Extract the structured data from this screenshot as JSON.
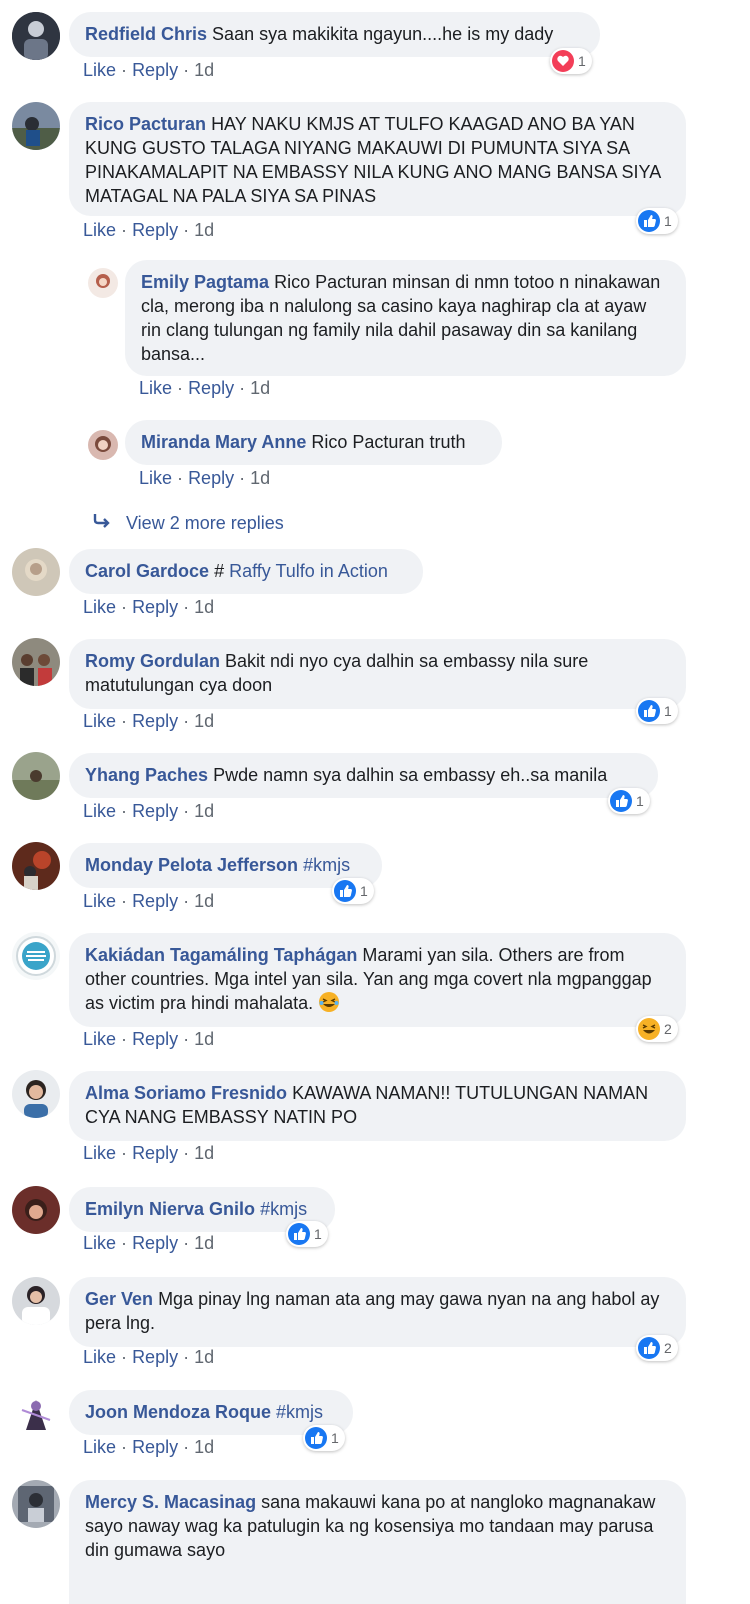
{
  "actions": {
    "like": "Like",
    "reply": "Reply",
    "sep": "·"
  },
  "comments": [
    {
      "author": "Redfield Chris",
      "text": "Saan sya makikita ngayun....he is my dady",
      "time": "1d",
      "reaction": {
        "icon": "heart-icon",
        "count": "1"
      }
    },
    {
      "author": "Rico Pacturan",
      "text": "HAY NAKU KMJS AT TULFO KAAGAD ANO BA YAN KUNG GUSTO TALAGA NIYANG MAKAUWI DI PUMUNTA SIYA SA PINAKAMALAPIT NA EMBASSY NILA KUNG ANO MANG BANSA SIYA MATAGAL NA PALA SIYA SA PINAS",
      "time": "1d",
      "reaction": {
        "icon": "like-icon",
        "count": "1"
      }
    },
    {
      "author": "Emily Pagtama",
      "text": "Rico Pacturan minsan di nmn totoo n ninakawan cla, merong iba n nalulong sa casino kaya naghirap cla at ayaw rin clang tulungan ng family nila dahil pasaway din sa kanilang bansa...",
      "time": "1d"
    },
    {
      "author": "Miranda Mary Anne",
      "text": "Rico Pacturan truth",
      "time": "1d"
    },
    {
      "author": "Carol Gardoce",
      "text": "#",
      "link": "Raffy Tulfo in Action",
      "time": "1d"
    },
    {
      "author": "Romy Gordulan",
      "text": "Bakit ndi nyo cya dalhin sa embassy nila sure matutulungan cya doon",
      "time": "1d",
      "reaction": {
        "icon": "like-icon",
        "count": "1"
      }
    },
    {
      "author": "Yhang Paches",
      "text": "Pwde namn sya dalhin sa embassy eh..sa manila",
      "time": "1d",
      "reaction": {
        "icon": "like-icon",
        "count": "1"
      }
    },
    {
      "author": "Monday Pelota Jefferson",
      "text": "#kmjs",
      "time": "1d",
      "reaction": {
        "icon": "like-icon",
        "count": "1"
      }
    },
    {
      "author": "Kakiádan Tagamáling Taphágan",
      "text": "Marami yan sila. Others are from other countries. Mga intel yan sila. Yan ang mga covert nla mgpanggap as victim pra hindi mahalata.",
      "time": "1d",
      "emoji": "laughing-emoji-icon",
      "reaction": {
        "icon": "haha-icon",
        "count": "2"
      }
    },
    {
      "author": "Alma Soriamo Fresnido",
      "text": "KAWAWA NAMAN!! TUTULUNGAN NAMAN CYA NANG EMBASSY NATIN PO",
      "time": "1d"
    },
    {
      "author": "Emilyn Nierva Gnilo",
      "text": "#kmjs",
      "time": "1d",
      "reaction": {
        "icon": "like-icon",
        "count": "1"
      }
    },
    {
      "author": "Ger Ven",
      "text": "Mga pinay lng naman ata ang may gawa nyan na ang habol ay pera lng.",
      "time": "1d",
      "reaction": {
        "icon": "like-icon",
        "count": "2"
      }
    },
    {
      "author": "Joon Mendoza Roque",
      "text": "#kmjs",
      "time": "1d",
      "reaction": {
        "icon": "like-icon",
        "count": "1"
      }
    },
    {
      "author": "Mercy S. Macasinag",
      "text": "sana makauwi kana po at nangloko magnanakaw sayo naway wag ka patulugin ka ng kosensiya mo tandaan may parusa din gumawa sayo",
      "time": ""
    }
  ],
  "view_more": {
    "label": "View 2 more replies",
    "icon": "reply-arrow-icon"
  },
  "colors": {
    "link": "#385898",
    "bubble": "#f0f2f5",
    "like_blue": "#1877f2",
    "heart_red": "#f33e58",
    "haha_yellow": "#f7b125"
  }
}
